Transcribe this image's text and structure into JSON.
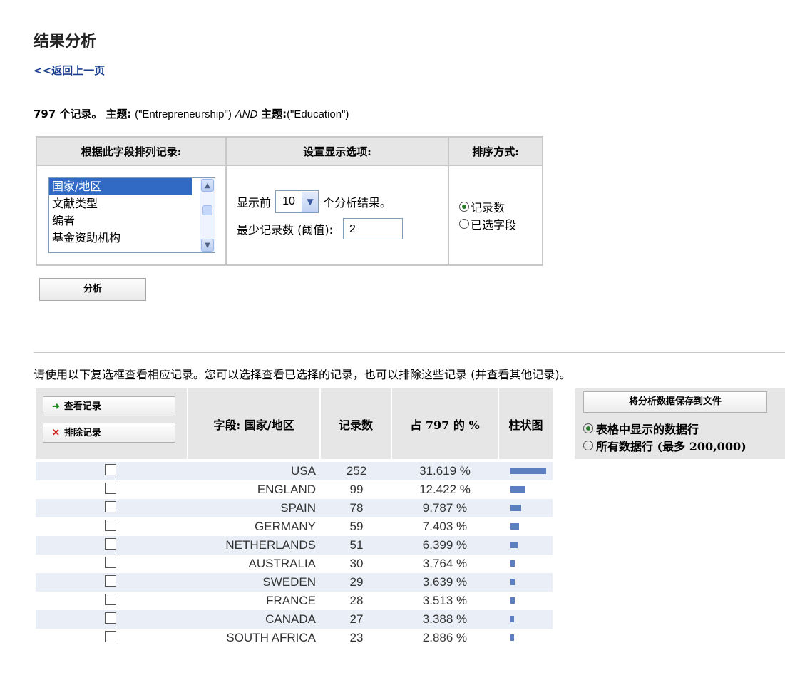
{
  "page": {
    "title": "结果分析",
    "back_link": "<<返回上一页"
  },
  "query": {
    "count": "797 个记录。",
    "topic_label_1": "主题:",
    "topic_value_1": "(\"Entrepreneurship\")",
    "operator": "AND",
    "topic_label_2": "主题:",
    "topic_value_2": "(\"Education\")"
  },
  "options": {
    "headers": [
      "根据此字段排列记录:",
      "设置显示选项:",
      "排序方式:"
    ],
    "field_list": [
      "国家/地区",
      "文献类型",
      "编者",
      "基金资助机构"
    ],
    "selected_field": "国家/地区",
    "display_prefix": "显示前",
    "display_value": "10",
    "display_suffix": "个分析结果。",
    "threshold_label": "最少记录数 (阈值):",
    "threshold_value": "2",
    "sort_options": [
      "记录数",
      "已选字段"
    ],
    "sort_selected": "记录数"
  },
  "analyze_button": "分析",
  "instruction": "请使用以下复选框查看相应记录。您可以选择查看已选择的记录，也可以排除这些记录 (并查看其他记录)。",
  "results": {
    "view_button": "查看记录",
    "exclude_button": "排除记录",
    "headers": [
      "字段: 国家/地区",
      "记录数",
      "占 797 的 %",
      "柱状图"
    ],
    "rows": [
      {
        "country": "USA",
        "count": 252,
        "pct": "31.619 %"
      },
      {
        "country": "ENGLAND",
        "count": 99,
        "pct": "12.422 %"
      },
      {
        "country": "SPAIN",
        "count": 78,
        "pct": "9.787 %"
      },
      {
        "country": "GERMANY",
        "count": 59,
        "pct": "7.403 %"
      },
      {
        "country": "NETHERLANDS",
        "count": 51,
        "pct": "6.399 %"
      },
      {
        "country": "AUSTRALIA",
        "count": 30,
        "pct": "3.764 %"
      },
      {
        "country": "SWEDEN",
        "count": 29,
        "pct": "3.639 %"
      },
      {
        "country": "FRANCE",
        "count": 28,
        "pct": "3.513 %"
      },
      {
        "country": "CANADA",
        "count": 27,
        "pct": "3.388 %"
      },
      {
        "country": "SOUTH AFRICA",
        "count": 23,
        "pct": "2.886 %"
      }
    ]
  },
  "save": {
    "button": "将分析数据保存到文件",
    "option_1": "表格中显示的数据行",
    "option_2": "所有数据行 (最多 200,000)",
    "selected": "表格中显示的数据行"
  }
}
